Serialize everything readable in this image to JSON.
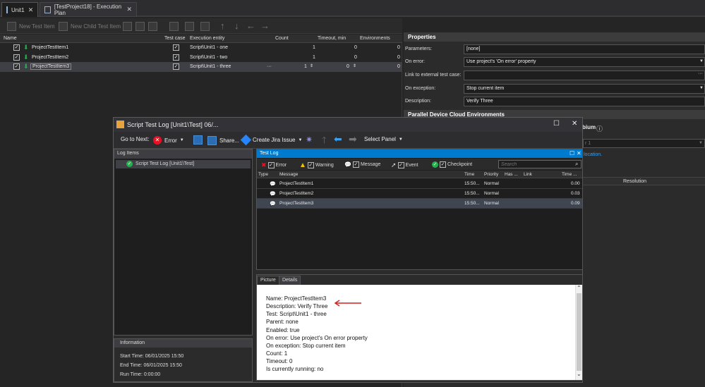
{
  "tabs": [
    {
      "label": "Unit1",
      "close": "✕"
    },
    {
      "label": "[TestProject18] - Execution Plan",
      "close": "✕"
    }
  ],
  "toolbar": {
    "new_test_item": "New Test Item",
    "new_child_test_item": "New Child Test Item"
  },
  "grid": {
    "headers": {
      "name": "Name",
      "test_case": "Test case",
      "execution_entity": "Execution entity",
      "count": "Count",
      "timeout": "Timeout, min",
      "environments": "Environments"
    },
    "rows": [
      {
        "name": "ProjectTestItem1",
        "entity": "Script\\Unit1 - one",
        "count": "1",
        "timeout": "0",
        "env": "0"
      },
      {
        "name": "ProjectTestItem2",
        "entity": "Script\\Unit1 - two",
        "count": "1",
        "timeout": "0",
        "env": "0"
      },
      {
        "name": "ProjectTestItem3",
        "entity": "Script\\Unit1 - three",
        "count": "1",
        "timeout": "0",
        "env": "0",
        "ellipsis": "···"
      }
    ]
  },
  "properties": {
    "title": "Properties",
    "parameters_label": "Parameters:",
    "parameters_value": "[none]",
    "on_error_label": "On error:",
    "on_error_value": "Use project's 'On error' property",
    "link_label": "Link to external test case:",
    "link_value": "",
    "on_exception_label": "On exception:",
    "on_exception_value": "Stop current item",
    "description_label": "Description:",
    "description_value": "Verify Three",
    "parallel_header": "Parallel Device Cloud Environments",
    "partial_text_1": "bium",
    "partial_text_2": "r 1",
    "partial_text_3": "location.",
    "resolution_header": "Resolution"
  },
  "dialog": {
    "title": "Script Test Log [Unit1\\Test] 06/...",
    "maximize": "☐",
    "close": "✕",
    "toolbar": {
      "go_to_next": "Go to Next:",
      "error": "Error",
      "share": "Share...",
      "create_jira": "Create Jira Issue",
      "select_panel": "Select Panel"
    },
    "log_items": {
      "header": "Log Items",
      "item": "Script Test Log [Unit1\\Test]"
    },
    "test_log": {
      "header": "Test Log",
      "filters": {
        "error": "Error",
        "warning": "Warning",
        "message": "Message",
        "event": "Event",
        "checkpoint": "Checkpoint"
      },
      "search_placeholder": "Search",
      "columns": {
        "type": "Type",
        "message": "Message",
        "time": "Time",
        "priority": "Priority",
        "has": "Has ...",
        "link": "Link",
        "time2": "Time ..."
      },
      "rows": [
        {
          "message": "ProjectTestItem1",
          "time": "15:50...",
          "priority": "Normal",
          "duration": "0.00"
        },
        {
          "message": "ProjectTestItem2",
          "time": "15:50...",
          "priority": "Normal",
          "duration": "0.03"
        },
        {
          "message": "ProjectTestItem3",
          "time": "15:50...",
          "priority": "Normal",
          "duration": "0.09"
        }
      ]
    },
    "details": {
      "tab_picture": "Picture",
      "tab_details": "Details",
      "lines": [
        "Name: ProjectTestItem3",
        "Description: Verify Three",
        "Test: Script\\Unit1 - three",
        "Parent: none",
        "Enabled: true",
        "On error: Use project's On error property",
        "On exception: Stop current item",
        "Count: 1",
        "Timeout: 0",
        "Is currently running: no"
      ]
    },
    "information": {
      "header": "Information",
      "start": "Start Time: 06/01/2025 15:50",
      "end": "End Time: 06/01/2025 15:50",
      "run": "Run Time: 0:00:00"
    }
  },
  "colors": {
    "accent": "#007acc",
    "error": "#e81123",
    "warning": "#f5c400",
    "check_green": "#22b14c",
    "annotation_arrow": "#d42020"
  }
}
